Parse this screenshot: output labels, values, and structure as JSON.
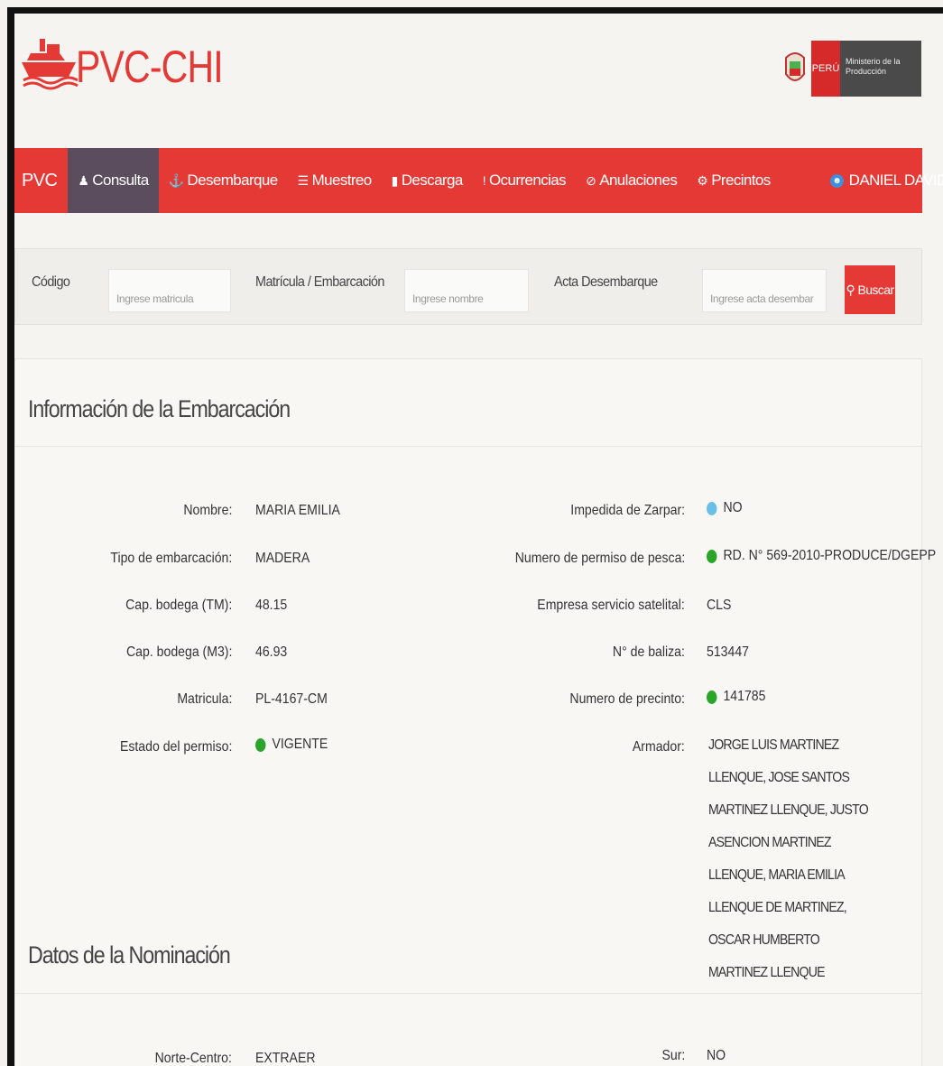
{
  "app": {
    "logo_text": "PVC-CHI",
    "gov_badge": "PERÚ",
    "gov_ministry": "Ministerio de la Producción"
  },
  "navbar": {
    "brand": "PVC",
    "items": [
      {
        "label": "Consulta",
        "icon": "user-icon",
        "active": true
      },
      {
        "label": "Desembarque",
        "icon": "anchor-icon"
      },
      {
        "label": "Muestreo",
        "icon": "list-icon"
      },
      {
        "label": "Descarga",
        "icon": "bar-chart-icon"
      },
      {
        "label": "Ocurrencias",
        "icon": "exclamation-icon"
      },
      {
        "label": "Anulaciones",
        "icon": "ban-icon"
      },
      {
        "label": "Precintos",
        "icon": "gear-icon"
      }
    ],
    "user": "DANIEL DAVID DAVILA RAICO - Inspector"
  },
  "search": {
    "codigo_label": "Código",
    "codigo_placeholder": "Ingrese matricula",
    "matricula_label": "Matrícula / Embarcación",
    "matricula_placeholder": "Ingrese nombre",
    "acta_label": "Acta Desembarque",
    "acta_placeholder": "Ingrese acta desembar",
    "buscar_label": "Buscar"
  },
  "embarcacion": {
    "title": "Información de la Embarcación",
    "left": [
      {
        "label": "Nombre:",
        "value": "MARIA EMILIA"
      },
      {
        "label": "Tipo de embarcación:",
        "value": "MADERA"
      },
      {
        "label": "Cap. bodega (TM):",
        "value": "48.15"
      },
      {
        "label": "Cap. bodega (M3):",
        "value": "46.93"
      },
      {
        "label": "Matricula:",
        "value": "PL-4167-CM"
      },
      {
        "label": "Estado del permiso:",
        "value": "VIGENTE",
        "status": "green"
      }
    ],
    "right": [
      {
        "label": "Impedida de Zarpar:",
        "value": "NO",
        "status": "blue"
      },
      {
        "label": "Numero de permiso de pesca:",
        "value": "RD. N° 569-2010-PRODUCE/DGEPP",
        "status": "green"
      },
      {
        "label": "Empresa servicio satelital:",
        "value": "CLS"
      },
      {
        "label": "N° de baliza:",
        "value": "513447"
      },
      {
        "label": "Numero de precinto:",
        "value": "141785",
        "status": "green"
      }
    ],
    "armador_label": "Armador:",
    "armador_value": "JORGE LUIS MARTINEZ LLENQUE, JOSE SANTOS MARTINEZ LLENQUE, JUSTO ASENCION MARTINEZ LLENQUE, MARIA EMILIA LLENQUE DE MARTINEZ, OSCAR HUMBERTO MARTINEZ LLENQUE"
  },
  "nominacion": {
    "title": "Datos de la Nominación",
    "norte_label": "Norte-Centro:",
    "norte_value": "EXTRAER",
    "sur_label": "Sur:",
    "sur_value": "NO"
  },
  "colors": {
    "primary": "#e53935",
    "nav_active": "#5b4d5e",
    "status_green": "#2aa52a",
    "status_blue": "#6bbfe6"
  }
}
